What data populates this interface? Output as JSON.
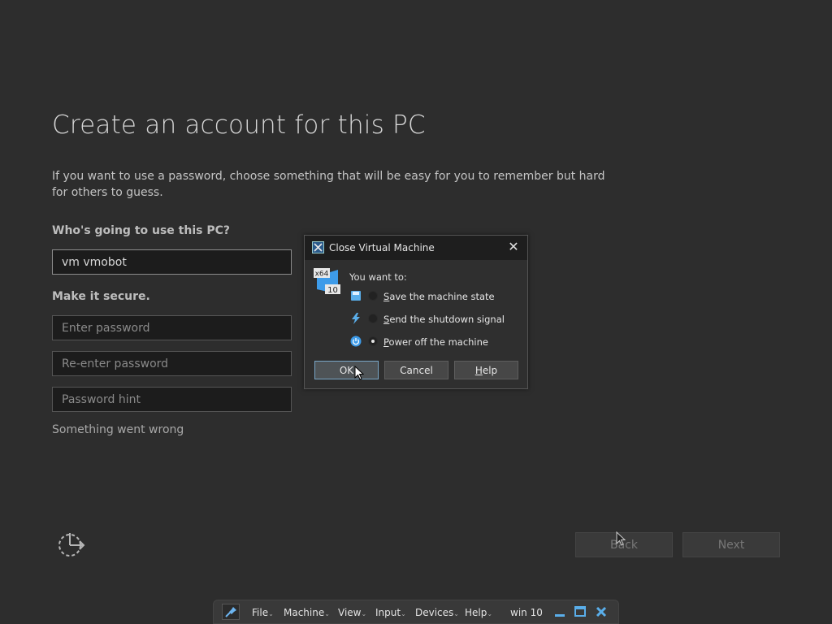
{
  "page": {
    "title": "Create an account for this PC",
    "description": "If you want to use a password, choose something that will be easy for you to remember but hard for others to guess.",
    "who_label": "Who's going to use this PC?",
    "username_value": "vm vmobot",
    "secure_label": "Make it secure.",
    "password_placeholder": "Enter password",
    "reenter_placeholder": "Re-enter password",
    "hint_placeholder": "Password hint",
    "error_text": "Something went wrong",
    "back_label": "Back",
    "next_label": "Next"
  },
  "dialog": {
    "title": "Close Virtual Machine",
    "prompt": "You want to:",
    "badge_arch": "x64",
    "badge_version": "10",
    "options": [
      {
        "label": "Save the machine state",
        "icon": "save-state-icon",
        "selected": false
      },
      {
        "label": "Send the shutdown signal",
        "icon": "lightning-icon",
        "selected": false
      },
      {
        "label": "Power off the machine",
        "icon": "power-icon",
        "selected": true
      }
    ],
    "ok_label": "OK",
    "cancel_label": "Cancel",
    "help_label": "Help"
  },
  "vm_toolbar": {
    "menus": [
      "File",
      "Machine",
      "View",
      "Input",
      "Devices",
      "Help"
    ],
    "vm_name": "win 10"
  },
  "colors": {
    "background": "#2d2d2d",
    "dialog_titlebar": "#1e1e1e",
    "accent_blue": "#3d9be9"
  }
}
